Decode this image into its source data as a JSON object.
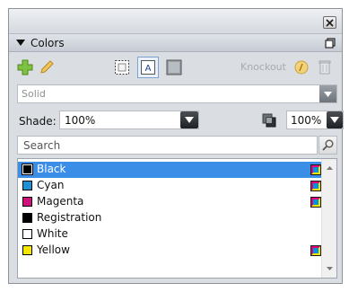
{
  "panel": {
    "title": "Colors",
    "knockout_label": "Knockout",
    "fill_type": "Solid",
    "shade_label": "Shade:",
    "shade_value": "100%",
    "opacity_value": "100%"
  },
  "search": {
    "placeholder": "Search"
  },
  "colors": [
    {
      "name": "Black",
      "swatch": "#000000",
      "process_icon": true,
      "selected": true
    },
    {
      "name": "Cyan",
      "swatch": "#1e90d6",
      "process_icon": true,
      "selected": false
    },
    {
      "name": "Magenta",
      "swatch": "#d0117a",
      "process_icon": true,
      "selected": false
    },
    {
      "name": "Registration",
      "swatch": "#000000",
      "process_icon": false,
      "selected": false
    },
    {
      "name": "White",
      "swatch": "#ffffff",
      "process_icon": false,
      "selected": false
    },
    {
      "name": "Yellow",
      "swatch": "#f5e600",
      "process_icon": true,
      "selected": false
    }
  ],
  "icons": {
    "close": "close-icon",
    "collapse": "triangle-down-icon",
    "panel_menu": "panel-menu-icon",
    "add": "plus-icon",
    "edit": "pencil-icon",
    "frame_color": "frame-color-icon",
    "text_color": "text-color-icon",
    "background_color": "background-color-icon",
    "knockout": "knockout-icon",
    "delete": "trash-icon",
    "overprint": "overprint-icon",
    "search": "magnifier-icon",
    "process_color": "cmyk-icon"
  },
  "accent": {
    "selection": "#3a8ee6",
    "add_green": "#6fb52c"
  }
}
